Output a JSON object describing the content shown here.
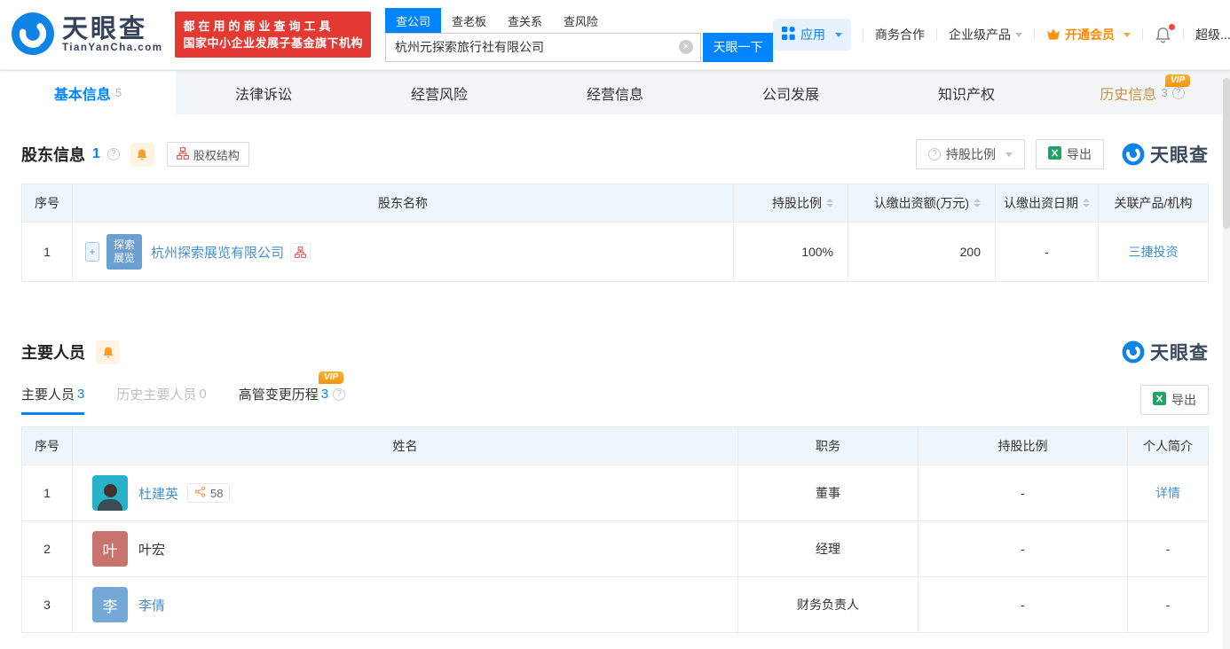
{
  "brand": {
    "name": "天眼查",
    "domain": "TianYanCha.com",
    "promo_line1": "都在用的商业查询工具",
    "promo_line2": "国家中小企业发展子基金旗下机构"
  },
  "search": {
    "tabs": {
      "company": "查公司",
      "boss": "查老板",
      "relation": "查关系",
      "risk": "查风险"
    },
    "value": "杭州元探索旅行社有限公司",
    "button": "天眼一下"
  },
  "nav": {
    "apps": "应用",
    "cooperation": "商务合作",
    "enterprise": "企业级产品",
    "membership": "开通会员",
    "super": "超级..."
  },
  "vip_label": "VIP",
  "tabs": {
    "basic": "基本信息",
    "basic_count": "5",
    "legal": "法律诉讼",
    "risk": "经营风险",
    "operation": "经营信息",
    "development": "公司发展",
    "ip": "知识产权",
    "history": "历史信息",
    "history_count": "3"
  },
  "shareholders": {
    "title": "股东信息",
    "count": "1",
    "structure_btn": "股权结构",
    "ratio_btn": "持股比例",
    "export_btn": "导出",
    "watermark": "天眼查",
    "col_index": "序号",
    "col_name": "股东名称",
    "col_ratio": "持股比例",
    "col_amount": "认缴出资额(万元)",
    "col_date": "认缴出资日期",
    "col_related": "关联产品/机构",
    "rows": [
      {
        "index": "1",
        "expand": "+",
        "avatar_l1": "探索",
        "avatar_l2": "展览",
        "name": "杭州探索展览有限公司",
        "ratio": "100%",
        "amount": "200",
        "date": "-",
        "related": "三捷投资"
      }
    ]
  },
  "staff": {
    "title": "主要人员",
    "tab_main": "主要人员",
    "tab_main_count": "3",
    "tab_history": "历史主要人员",
    "tab_history_count": "0",
    "tab_changes": "高管变更历程",
    "tab_changes_count": "3",
    "export_btn": "导出",
    "watermark": "天眼查",
    "col_index": "序号",
    "col_name": "姓名",
    "col_position": "职务",
    "col_ratio": "持股比例",
    "col_profile": "个人简介",
    "rows": [
      {
        "index": "1",
        "name": "杜建英",
        "badge_count": "58",
        "position": "董事",
        "ratio": "-",
        "profile": "详情"
      },
      {
        "index": "2",
        "name": "叶宏",
        "avatar_char": "叶",
        "position": "经理",
        "ratio": "-",
        "profile": "-"
      },
      {
        "index": "3",
        "name": "李倩",
        "avatar_char": "李",
        "position": "财务负责人",
        "ratio": "-",
        "profile": "-"
      }
    ]
  },
  "colors": {
    "accent": "#0084ff",
    "vip_orange": "#ff8a00",
    "promo_red": "#e23a33",
    "link_blue": "#4790d0",
    "table_header_bg": "#eef6fc"
  }
}
